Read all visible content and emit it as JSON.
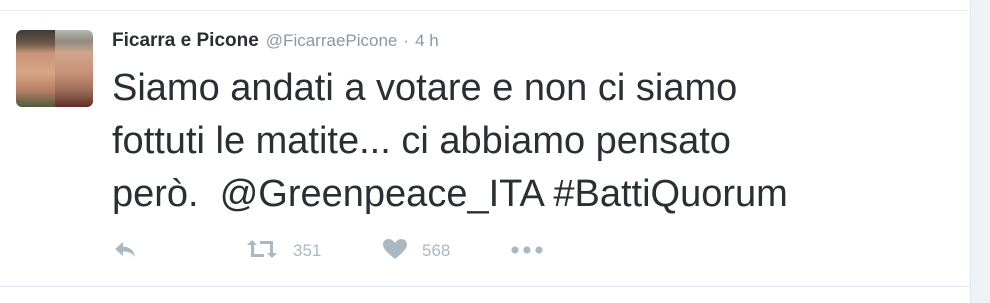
{
  "tweet": {
    "author_name": "Ficarra e Picone",
    "handle": "@FicarraePicone",
    "separator": "·",
    "time": "4 h",
    "text": "Siamo andati a votare e non ci siamo\nfottuti le matite... ci abbiamo pensato\nperò.  @Greenpeace_ITA #BattiQuorum"
  },
  "actions": {
    "reply_icon": "reply-icon",
    "retweet_icon": "retweet-icon",
    "retweet_count": "351",
    "like_icon": "heart-icon",
    "like_count": "568",
    "more_icon": "more-icon"
  },
  "colors": {
    "text": "#292f33",
    "muted": "#8899a6",
    "icon": "#aab8c2"
  }
}
